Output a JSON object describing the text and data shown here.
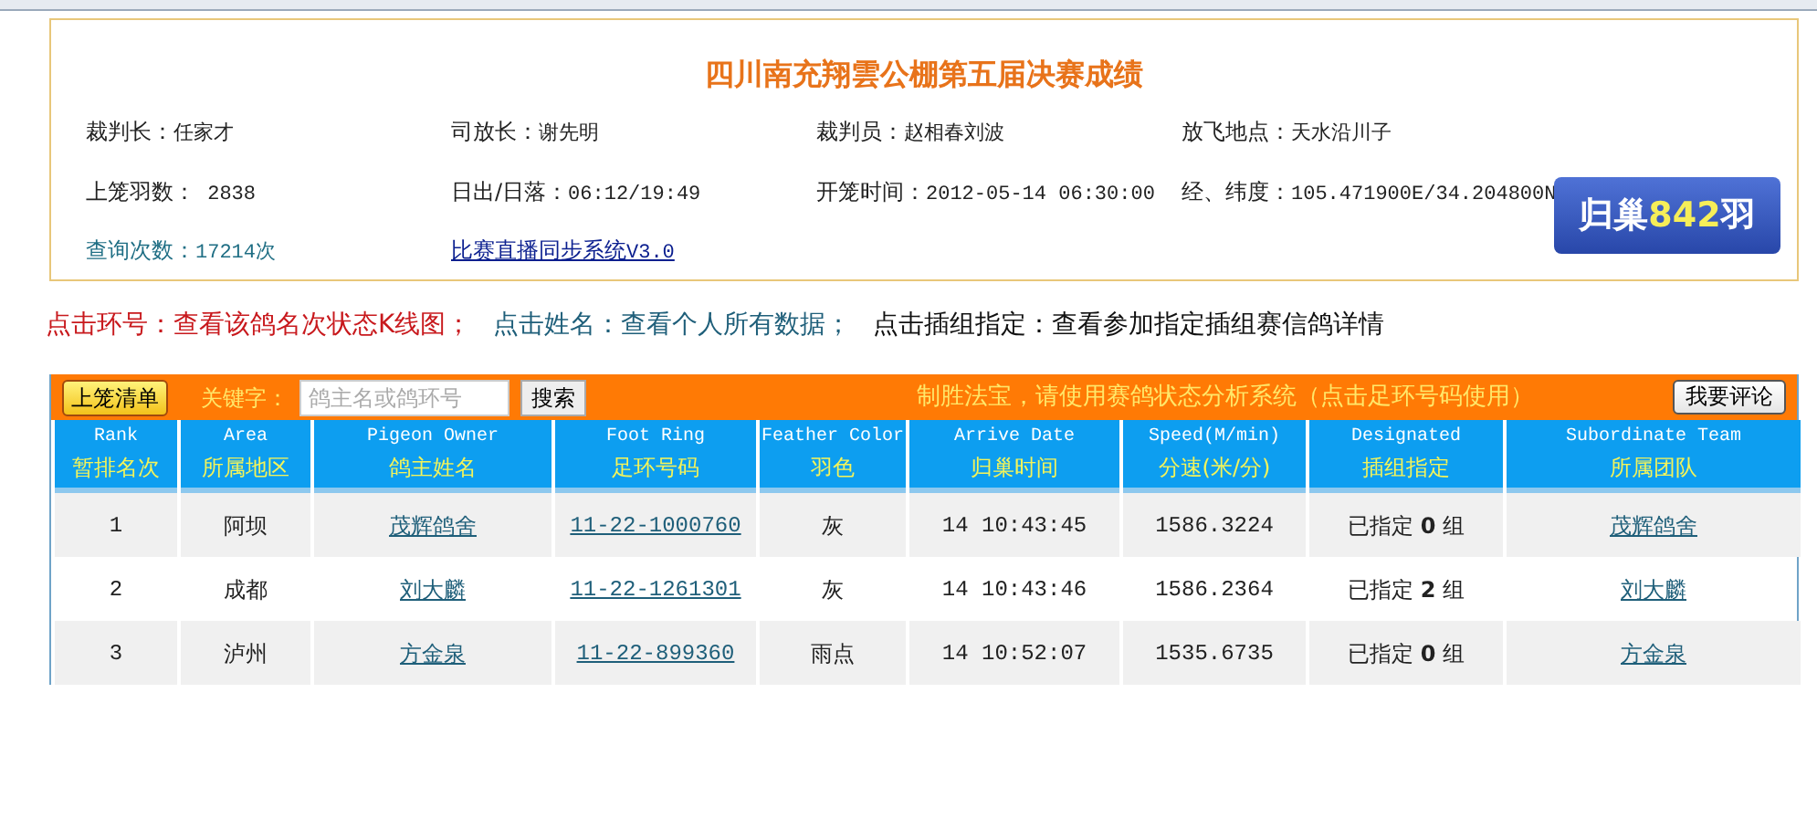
{
  "header": {
    "title": "四川南充翔雲公棚第五届决赛成绩",
    "info": [
      {
        "label": "裁判长：",
        "value": "任家才",
        "kind": "plain"
      },
      {
        "label": "司放长：",
        "value": "谢先明",
        "kind": "plain"
      },
      {
        "label": "裁判员：",
        "value": "赵相春刘波",
        "kind": "plain"
      },
      {
        "label": "放飞地点：",
        "value": "天水沿川子",
        "kind": "plain"
      },
      {
        "label": "上笼羽数：",
        "value": " 2838",
        "kind": "plain"
      },
      {
        "label": "日出/日落：",
        "value": "06:12/19:49",
        "kind": "plain"
      },
      {
        "label": "开笼时间：",
        "value": "2012-05-14 06:30:00",
        "kind": "plain"
      },
      {
        "label": "经、纬度：",
        "value": "105.471900E/34.204800N",
        "kind": "plain"
      },
      {
        "label": "查询次数：",
        "value": "17214次",
        "kind": "stat"
      },
      {
        "label": "比赛直播同步系统",
        "value": "V3.0",
        "kind": "link"
      }
    ],
    "homing": {
      "prefix": "归巢",
      "count": "842",
      "suffix": "羽"
    }
  },
  "notes": [
    {
      "text": "点击环号：查看该鸽名次状态K线图；",
      "kind": "alert"
    },
    {
      "text": "点击姓名：查看个人所有数据；",
      "kind": "link"
    },
    {
      "text": "点击插组指定：查看参加指定插组赛信鸽详情",
      "kind": "plain"
    }
  ],
  "toolbar": {
    "list_button": "上笼清单",
    "keyword_label": "关键字：",
    "search": {
      "placeholder": "鸽主名或鸽环号"
    },
    "search_button": "搜索",
    "promo": "制胜法宝，请使用赛鸽状态分析系统（点击足环号码使用）",
    "comment_button": "我要评论"
  },
  "table": {
    "columns": [
      {
        "en": "Rank",
        "zh": "暂排名次"
      },
      {
        "en": "Area",
        "zh": "所属地区"
      },
      {
        "en": "Pigeon Owner",
        "zh": "鸽主姓名"
      },
      {
        "en": "Foot Ring",
        "zh": "足环号码"
      },
      {
        "en": "Feather Color",
        "zh": "羽色"
      },
      {
        "en": "Arrive Date",
        "zh": "归巢时间"
      },
      {
        "en": "Speed(M/min)",
        "zh": "分速(米/分)"
      },
      {
        "en": "Designated",
        "zh": "插组指定"
      },
      {
        "en": "Subordinate Team",
        "zh": "所属团队"
      }
    ],
    "rows": [
      [
        "1",
        "阿坝",
        "茂辉鸽舍",
        "11-22-1000760",
        "灰",
        "14 10:43:45",
        "1586.3224",
        "已指定 **0** 组",
        "茂辉鸽舍"
      ],
      [
        "2",
        "成都",
        "刘大麟",
        "11-22-1261301",
        "灰",
        "14 10:43:46",
        "1586.2364",
        "已指定 **2** 组",
        "刘大麟"
      ],
      [
        "3",
        "泸州",
        "方金泉",
        "11-22-899360",
        "雨点",
        "14 10:52:07",
        "1535.6735",
        "已指定 **0** 组",
        "方金泉"
      ]
    ]
  }
}
